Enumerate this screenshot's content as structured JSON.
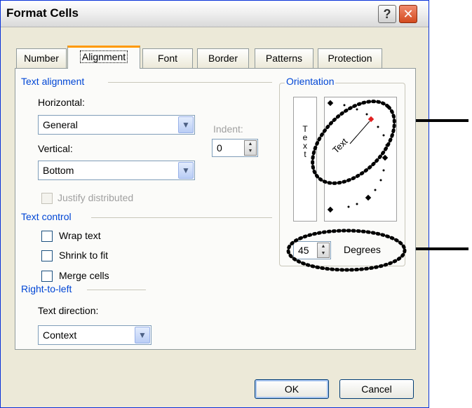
{
  "window": {
    "title": "Format Cells"
  },
  "tabs": [
    {
      "label": "Number"
    },
    {
      "label": "Alignment",
      "active": true
    },
    {
      "label": "Font"
    },
    {
      "label": "Border"
    },
    {
      "label": "Patterns"
    },
    {
      "label": "Protection"
    }
  ],
  "text_alignment": {
    "section_label": "Text alignment",
    "horizontal_label": "Horizontal:",
    "horizontal_value": "General",
    "vertical_label": "Vertical:",
    "vertical_value": "Bottom",
    "indent_label": "Indent:",
    "indent_value": "0",
    "justify_distributed_label": "Justify distributed"
  },
  "text_control": {
    "section_label": "Text control",
    "wrap_text_label": "Wrap text",
    "shrink_to_fit_label": "Shrink to fit",
    "merge_cells_label": "Merge cells"
  },
  "right_to_left": {
    "section_label": "Right-to-left",
    "text_direction_label": "Text direction:",
    "text_direction_value": "Context"
  },
  "orientation": {
    "section_label": "Orientation",
    "vertical_text": "Text",
    "dial_text": "Text",
    "degrees_value": "45",
    "degrees_label": "Degrees"
  },
  "buttons": {
    "ok": "OK",
    "cancel": "Cancel"
  },
  "colors": {
    "accent": "#0046d5",
    "tab_highlight": "#ff9900",
    "dial_marker": "#e02020"
  },
  "icons": [
    "help-icon",
    "close-icon",
    "dropdown-arrow-icon",
    "spinner-icon",
    "checkbox-icon",
    "annotation-arrow-icon"
  ]
}
